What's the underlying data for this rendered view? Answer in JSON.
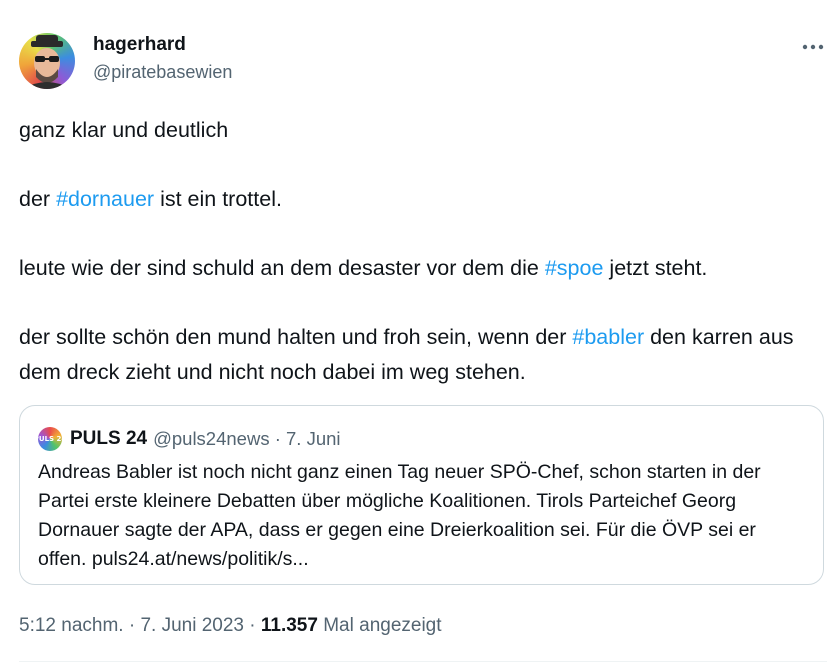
{
  "tweet": {
    "author": {
      "display_name": "hagerhard",
      "handle": "@piratebasewien",
      "avatar_icon": "avatar-person-rainbow"
    },
    "more_icon": "more-horizontal-icon",
    "paragraphs": [
      [
        "ganz klar und deutlich"
      ],
      [
        "der ",
        {
          "hashtag": "#dornauer"
        },
        " ist ein trottel."
      ],
      [
        "leute wie der sind schuld an dem desaster vor dem die ",
        {
          "hashtag": "#spoe"
        },
        " jetzt steht."
      ],
      [
        "der sollte schön den mund halten und froh sein, wenn der ",
        {
          "hashtag": "#babler"
        },
        " den karren aus dem dreck zieht und nicht noch dabei im weg stehen."
      ]
    ],
    "quote": {
      "avatar_text": "PULS 24",
      "name": "PULS 24",
      "meta": "@puls24news · 7. Juni",
      "text": "Andreas Babler ist noch nicht ganz einen Tag neuer SPÖ-Chef, schon starten in der Partei erste kleinere Debatten über mögliche Koalitionen. Tirols Parteichef Georg Dornauer sagte der APA, dass er gegen eine Dreierkoalition sei. Für die ÖVP sei er offen. puls24.at/news/politik/s..."
    },
    "timestamp": "5:12 nachm. · 7. Juni 2023 · ",
    "views_count": "11.357",
    "views_label": " Mal angezeigt"
  },
  "colors": {
    "text": "#0f1419",
    "secondary": "#536471",
    "link": "#1d9bf0",
    "border": "#cfd9de"
  }
}
